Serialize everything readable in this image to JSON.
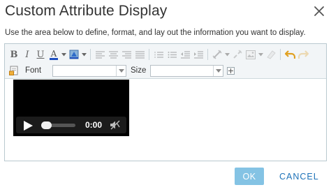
{
  "dialog": {
    "title": "Custom Attribute Display",
    "instructions": "Use the area below to define, format, and lay out the information you want to display."
  },
  "toolbar": {
    "row1": [
      "bold",
      "italic",
      "underline",
      "font-color",
      "highlight-color",
      "align-left",
      "align-center",
      "align-right",
      "justify",
      "ordered-list",
      "unordered-list",
      "outdent",
      "indent",
      "insert-link",
      "remove-link",
      "insert-image",
      "clear-format",
      "undo",
      "redo"
    ],
    "bold_label": "B",
    "italic_label": "I",
    "underline_label": "U",
    "font_color_label": "A",
    "font_label": "Font",
    "font_value": "",
    "size_label": "Size",
    "size_value": ""
  },
  "media": {
    "time": "0:00",
    "progress": 0
  },
  "buttons": {
    "ok": "OK",
    "cancel": "CANCEL"
  },
  "colors": {
    "accent": "#1d72b8",
    "ok_bg": "#84c3e4",
    "toolbar_bg": "#f2f5f7",
    "video_bg": "#000000"
  }
}
